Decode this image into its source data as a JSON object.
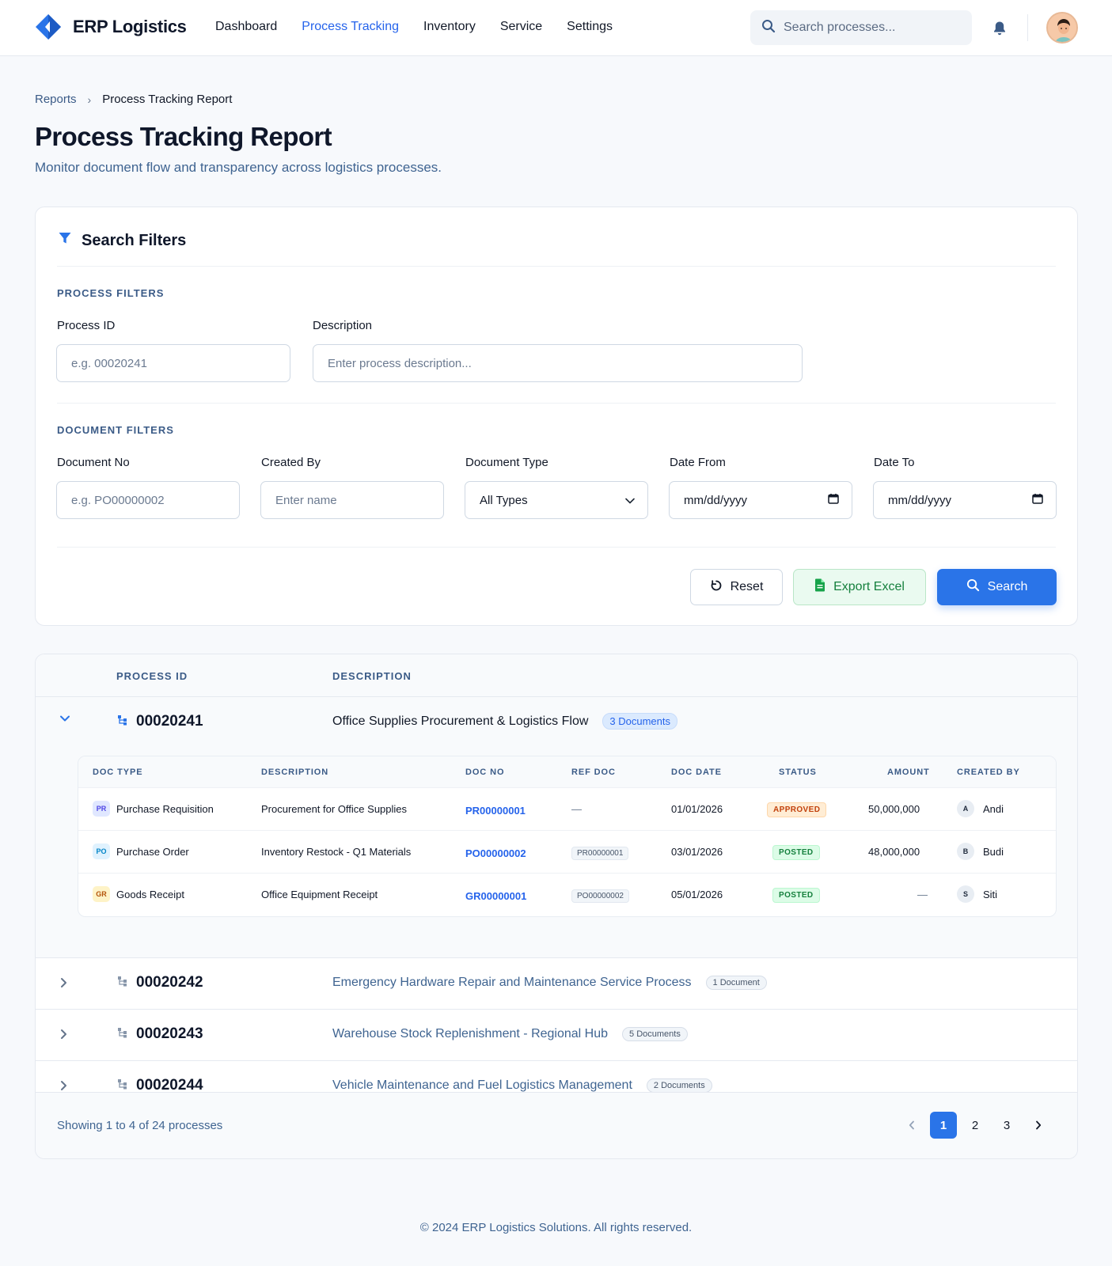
{
  "app": {
    "name": "ERP Logistics",
    "brand_color": "#2a74e8"
  },
  "nav": {
    "items": [
      "Dashboard",
      "Process Tracking",
      "Inventory",
      "Service",
      "Settings"
    ],
    "active": "Process Tracking"
  },
  "search": {
    "placeholder": "Search processes..."
  },
  "breadcrumb": {
    "parent": "Reports",
    "current": "Process Tracking Report"
  },
  "page": {
    "title": "Process Tracking Report",
    "subtitle": "Monitor document flow and transparency across logistics processes."
  },
  "filters": {
    "title": "Search Filters",
    "process_section": "PROCESS FILTERS",
    "process_id_label": "Process ID",
    "process_id_placeholder": "e.g. 00020241",
    "description_label": "Description",
    "description_placeholder": "Enter process description...",
    "document_section": "DOCUMENT FILTERS",
    "doc_no_label": "Document No",
    "doc_no_placeholder": "e.g. PO00000002",
    "created_by_label": "Created By",
    "created_by_placeholder": "Enter name",
    "doc_type_label": "Document Type",
    "doc_type_value": "All Types",
    "date_from_label": "Date From",
    "date_from_value": "mm/dd/yyyy",
    "date_to_label": "Date To",
    "date_to_value": "mm/dd/yyyy",
    "reset_label": "Reset",
    "export_label": "Export Excel",
    "search_label": "Search"
  },
  "table": {
    "col_process_id": "PROCESS ID",
    "col_description": "DESCRIPTION",
    "processes": [
      {
        "id": "00020241",
        "description": "Office Supplies Procurement & Logistics Flow",
        "badge": "3 Documents",
        "expanded": true
      },
      {
        "id": "00020242",
        "description": "Emergency Hardware Repair and Maintenance Service Process",
        "badge": "1 Document",
        "expanded": false
      },
      {
        "id": "00020243",
        "description": "Warehouse Stock Replenishment - Regional Hub",
        "badge": "5 Documents",
        "expanded": false
      },
      {
        "id": "00020244",
        "description": "Vehicle Maintenance and Fuel Logistics Management",
        "badge": "2 Documents",
        "expanded": false
      }
    ],
    "inner_headers": [
      "DOC TYPE",
      "DESCRIPTION",
      "DOC NO",
      "REF DOC",
      "DOC DATE",
      "STATUS",
      "AMOUNT",
      "CREATED BY"
    ],
    "documents": [
      {
        "tag": "PR",
        "tag_color": "#4f46e5",
        "tag_bg": "#e0e7ff",
        "type": "Purchase Requisition",
        "description": "Procurement for Office Supplies",
        "doc_no": "PR00000001",
        "ref_doc": "—",
        "date": "01/01/2026",
        "status": "APPROVED",
        "amount": "50,000,000",
        "initial": "A",
        "created_by": "Andi"
      },
      {
        "tag": "PO",
        "tag_color": "#0284c7",
        "tag_bg": "#e0f2fe",
        "type": "Purchase Order",
        "description": "Inventory Restock - Q1 Materials",
        "doc_no": "PO00000002",
        "ref_doc": "PR00000001",
        "date": "03/01/2026",
        "status": "POSTED",
        "amount": "48,000,000",
        "initial": "B",
        "created_by": "Budi"
      },
      {
        "tag": "GR",
        "tag_color": "#b45309",
        "tag_bg": "#fef3c7",
        "type": "Goods Receipt",
        "description": "Office Equipment Receipt",
        "doc_no": "GR00000001",
        "ref_doc": "PO00000002",
        "date": "05/01/2026",
        "status": "POSTED",
        "amount": "—",
        "initial": "S",
        "created_by": "Siti"
      }
    ],
    "showing": "Showing 1 to 4 of 24 processes",
    "pages": [
      "1",
      "2",
      "3"
    ],
    "current_page": "1"
  },
  "footer": {
    "text": "© 2024 ERP Logistics Solutions. All rights reserved."
  }
}
